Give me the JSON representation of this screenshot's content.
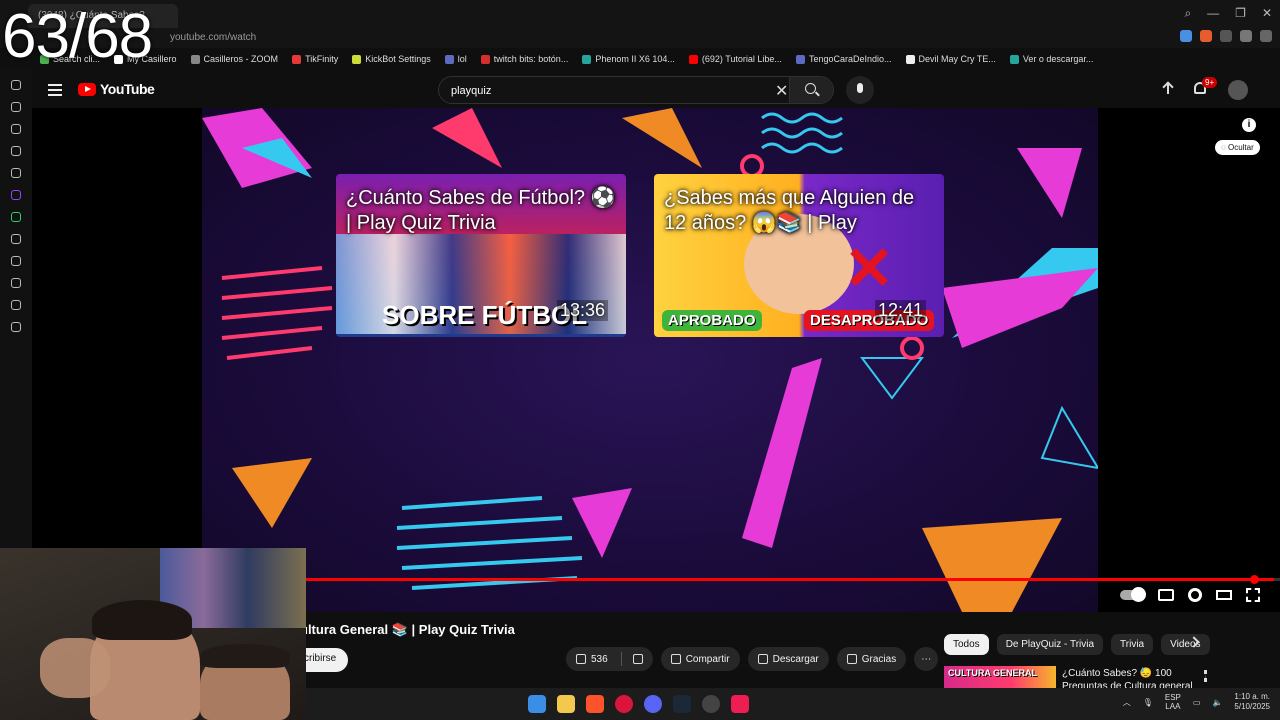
{
  "overlay_counter": "63/68",
  "browser": {
    "tab_title": "(3048) ¿Cuánto Sabes?",
    "url": "youtube.com/watch",
    "bookmarks": [
      {
        "label": "Search cli...",
        "color": "#4caf50"
      },
      {
        "label": "My Casillero",
        "color": "#ffffff"
      },
      {
        "label": "Casilleros - ZOOM",
        "color": "#888888"
      },
      {
        "label": "TikFinity",
        "color": "#e53935"
      },
      {
        "label": "KickBot Settings",
        "color": "#cddc39"
      },
      {
        "label": "lol",
        "color": "#5c6bc0"
      },
      {
        "label": "twitch bits: botón...",
        "color": "#d32f2f"
      },
      {
        "label": "Phenom II X6 104...",
        "color": "#26a69a"
      },
      {
        "label": "(692) Tutorial Libe...",
        "color": "#ff0000"
      },
      {
        "label": "TengoCaraDeIndio...",
        "color": "#5c6bc0"
      },
      {
        "label": "Devil May Cry TE...",
        "color": "#eeeeee"
      },
      {
        "label": "Ver o descargar...",
        "color": "#26a69a"
      }
    ]
  },
  "youtube": {
    "logo_text": "YouTube",
    "search_value": "playquiz",
    "notification_count": "9+"
  },
  "player": {
    "endcards": [
      {
        "title": "¿Cuánto Sabes de Fútbol? ⚽ | Play Quiz Trivia",
        "duration": "13:36",
        "big_text": "SOBRE FÚTBOL"
      },
      {
        "title": "¿Sabes más que Alguien de 12 años? 😱📚 | Play",
        "duration": "12:41",
        "tag_left": "APROBADO",
        "tag_right": "DESAPROBADO"
      }
    ],
    "hide_label": "Ocultar",
    "progress_fraction": 0.995
  },
  "video": {
    "title": "ultura General 📚 | Play Quiz Trivia",
    "subscribe_label": "cribirse",
    "likes": "536",
    "share_label": "Compartir",
    "download_label": "Descargar",
    "thanks_label": "Gracias"
  },
  "recommendations": {
    "chips": [
      "Todos",
      "De PlayQuiz - Trivia",
      "Trivia",
      "Videos"
    ],
    "first_title": "¿Cuánto Sabes? 😓 100 Preguntas de Cultura general",
    "first_thumb_text": "CULTURA GENERAL"
  },
  "taskbar": {
    "lang_line1": "ESP",
    "lang_line2": "LAA",
    "time": "1:10 a. m.",
    "date": "5/10/2025"
  },
  "colors": {
    "accent_red": "#ff0000",
    "pink": "#e63bd6",
    "cyan": "#36c9f0",
    "orange": "#f08a24"
  }
}
